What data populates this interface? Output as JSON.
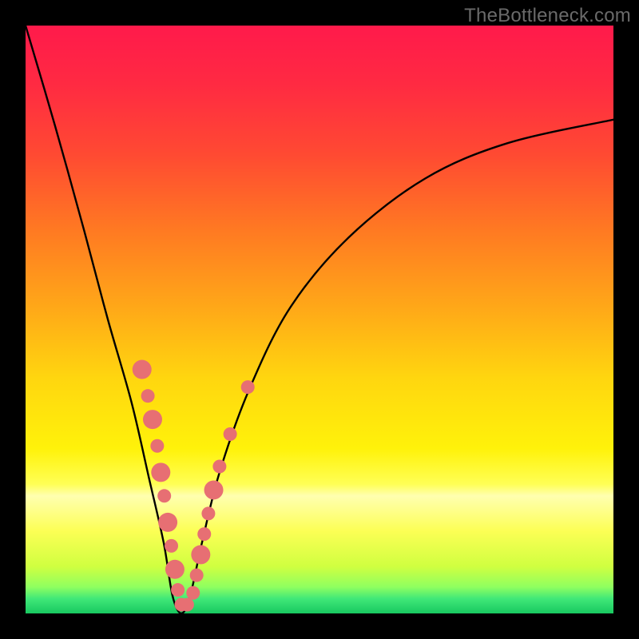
{
  "watermark": "TheBottleneck.com",
  "gradient": {
    "stops": [
      {
        "pos": 0.0,
        "color": "#ff1a4b"
      },
      {
        "pos": 0.1,
        "color": "#ff2a42"
      },
      {
        "pos": 0.22,
        "color": "#ff4a32"
      },
      {
        "pos": 0.35,
        "color": "#ff7a22"
      },
      {
        "pos": 0.48,
        "color": "#ffa818"
      },
      {
        "pos": 0.6,
        "color": "#ffd60f"
      },
      {
        "pos": 0.72,
        "color": "#fff20a"
      },
      {
        "pos": 0.78,
        "color": "#ffff55"
      },
      {
        "pos": 0.8,
        "color": "#ffffb0"
      },
      {
        "pos": 0.86,
        "color": "#fcff55"
      },
      {
        "pos": 0.92,
        "color": "#d0ff40"
      },
      {
        "pos": 0.955,
        "color": "#8fff60"
      },
      {
        "pos": 0.975,
        "color": "#40e878"
      },
      {
        "pos": 1.0,
        "color": "#18c860"
      }
    ]
  },
  "chart_data": {
    "type": "line",
    "title": "",
    "xlabel": "",
    "ylabel": "",
    "xlim": [
      0,
      100
    ],
    "ylim": [
      0,
      100
    ],
    "series": [
      {
        "name": "bottleneck-curve",
        "x": [
          0,
          5,
          10,
          14,
          18,
          21,
          23.5,
          25,
          26.5,
          28,
          30,
          33,
          38,
          45,
          55,
          68,
          82,
          100
        ],
        "y": [
          100,
          83,
          65,
          50,
          36,
          23,
          12,
          3,
          0,
          3,
          12,
          24,
          38,
          52,
          64,
          74,
          80,
          84
        ]
      }
    ],
    "markers": {
      "name": "sample-points",
      "color": "#e76f73",
      "radius_small": 8.5,
      "radius_large": 12,
      "points": [
        {
          "x": 19.8,
          "y": 41.5,
          "r": "large"
        },
        {
          "x": 20.8,
          "y": 37.0,
          "r": "small"
        },
        {
          "x": 21.6,
          "y": 33.0,
          "r": "large"
        },
        {
          "x": 22.4,
          "y": 28.5,
          "r": "small"
        },
        {
          "x": 23.0,
          "y": 24.0,
          "r": "large"
        },
        {
          "x": 23.6,
          "y": 20.0,
          "r": "small"
        },
        {
          "x": 24.2,
          "y": 15.5,
          "r": "large"
        },
        {
          "x": 24.8,
          "y": 11.5,
          "r": "small"
        },
        {
          "x": 25.4,
          "y": 7.5,
          "r": "large"
        },
        {
          "x": 25.9,
          "y": 4.0,
          "r": "small"
        },
        {
          "x": 26.5,
          "y": 1.5,
          "r": "small"
        },
        {
          "x": 27.5,
          "y": 1.5,
          "r": "small"
        },
        {
          "x": 28.5,
          "y": 3.5,
          "r": "small"
        },
        {
          "x": 29.1,
          "y": 6.5,
          "r": "small"
        },
        {
          "x": 29.8,
          "y": 10.0,
          "r": "large"
        },
        {
          "x": 30.4,
          "y": 13.5,
          "r": "small"
        },
        {
          "x": 31.1,
          "y": 17.0,
          "r": "small"
        },
        {
          "x": 32.0,
          "y": 21.0,
          "r": "large"
        },
        {
          "x": 33.0,
          "y": 25.0,
          "r": "small"
        },
        {
          "x": 34.8,
          "y": 30.5,
          "r": "small"
        },
        {
          "x": 37.8,
          "y": 38.5,
          "r": "small"
        }
      ]
    }
  }
}
